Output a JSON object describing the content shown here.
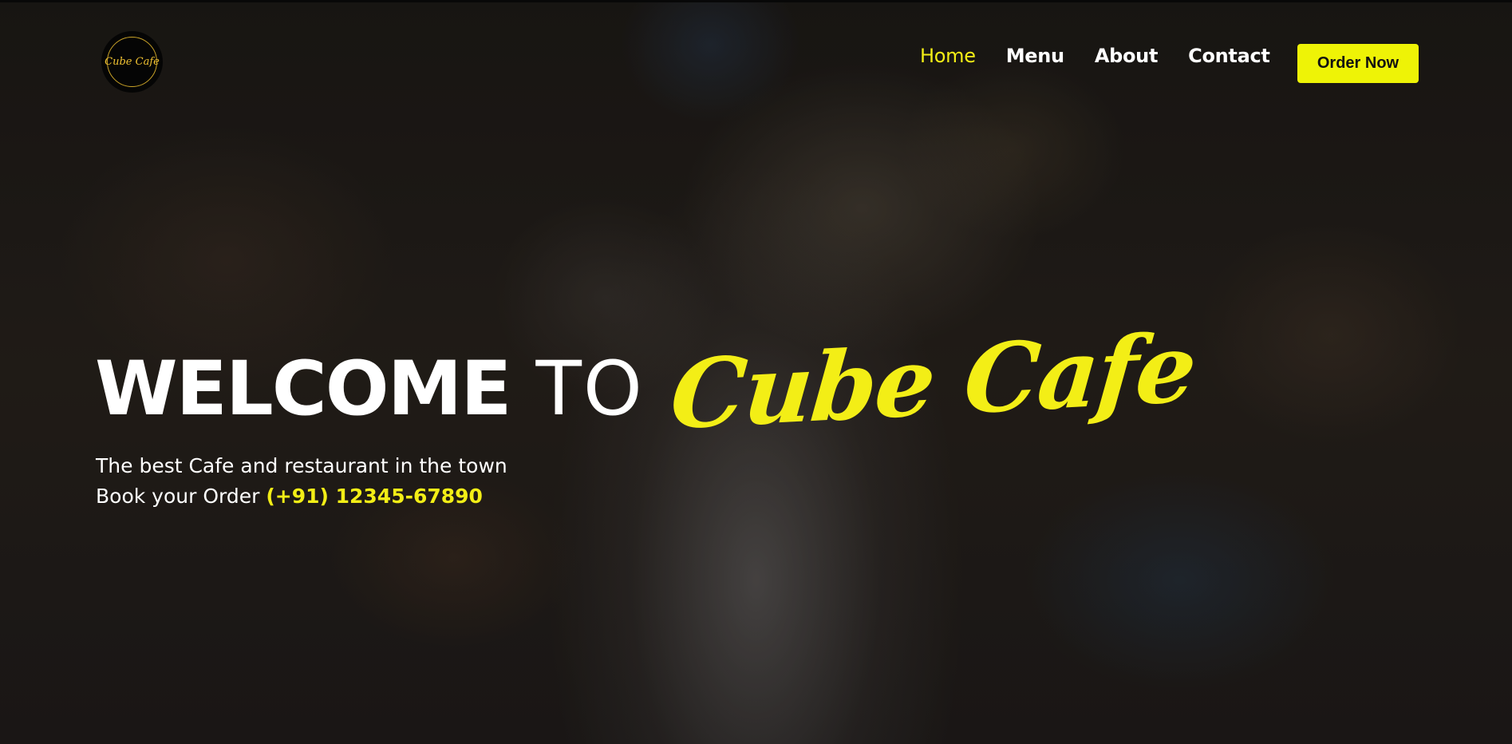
{
  "colors": {
    "accent": "#f3ee16",
    "button_bg": "#eef306",
    "text": "#ffffff",
    "logo_bg": "#050505"
  },
  "logo": {
    "text": "Cube Cafe",
    "icon": "cafe-logo-icon"
  },
  "nav": {
    "items": [
      {
        "label": "Home",
        "active": true
      },
      {
        "label": "Menu",
        "active": false
      },
      {
        "label": "About",
        "active": false
      },
      {
        "label": "Contact",
        "active": false
      }
    ],
    "cta_label": "Order Now"
  },
  "hero": {
    "welcome": "WELCOME",
    "to": "TO",
    "brand": "Cube Cafe",
    "tagline": "The best Cafe and restaurant in the town",
    "order_prefix": "Book your Order",
    "phone": "(+91) 12345-67890"
  }
}
